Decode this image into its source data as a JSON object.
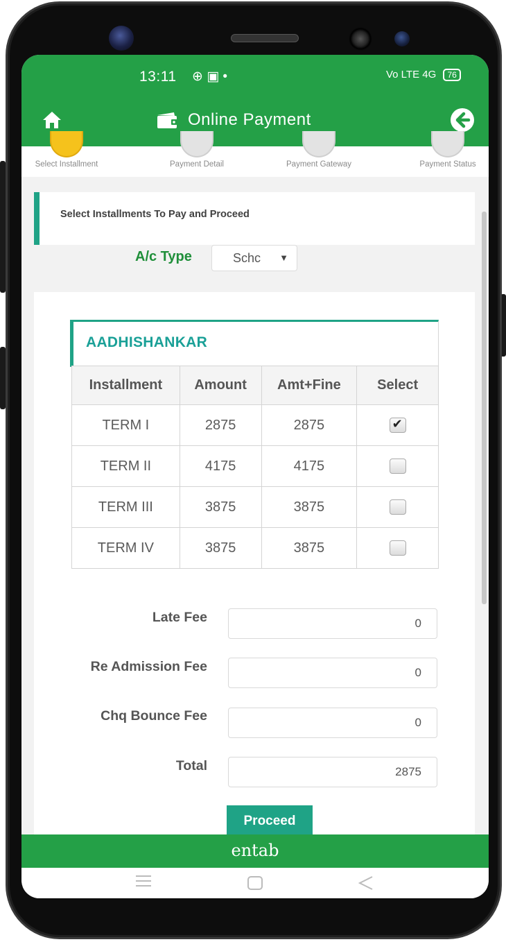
{
  "status_bar": {
    "time": "13:11",
    "left_icons": "⊕ ▣ •",
    "network": "Vo LTE 4G",
    "battery": "76"
  },
  "app_bar": {
    "title": "Online Payment",
    "home_icon": "home-icon",
    "back_icon": "back-arrow-icon"
  },
  "steps": [
    {
      "label": "Select Installment",
      "active": true
    },
    {
      "label": "Payment Detail",
      "active": false
    },
    {
      "label": "Payment Gateway",
      "active": false
    },
    {
      "label": "Payment Status",
      "active": false
    }
  ],
  "info": {
    "text": "Select Installments To Pay and Proceed"
  },
  "account_type": {
    "label": "A/c Type",
    "selected": "Schc"
  },
  "school": {
    "name": "AADHISHANKAR"
  },
  "table": {
    "headers": [
      "Installment",
      "Amount",
      "Amt+Fine",
      "Select"
    ],
    "rows": [
      {
        "installment": "TERM I",
        "amount": "2875",
        "amt_fine": "2875",
        "selected": true
      },
      {
        "installment": "TERM II",
        "amount": "4175",
        "amt_fine": "4175",
        "selected": false
      },
      {
        "installment": "TERM III",
        "amount": "3875",
        "amt_fine": "3875",
        "selected": false
      },
      {
        "installment": "TERM IV",
        "amount": "3875",
        "amt_fine": "3875",
        "selected": false
      }
    ]
  },
  "fees": {
    "late_fee": {
      "label": "Late Fee",
      "value": "0"
    },
    "readmission_fee": {
      "label": "Re Admission Fee",
      "value": "0"
    },
    "chq_bounce_fee": {
      "label": "Chq Bounce Fee",
      "value": "0"
    },
    "total": {
      "label": "Total",
      "value": "2875"
    }
  },
  "proceed_label": "Proceed",
  "footer": {
    "brand": "entab"
  },
  "colors": {
    "primary_green": "#24a047",
    "teal_accent": "#1fa386",
    "step_active": "#f5c21c"
  }
}
